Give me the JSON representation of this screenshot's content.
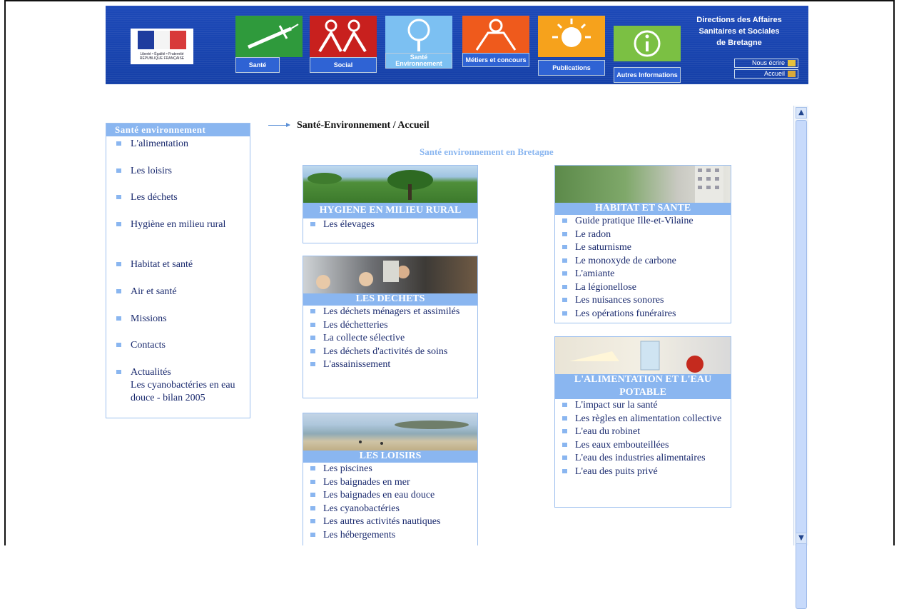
{
  "banner": {
    "logo_caption": "Liberté • Égalité • Fraternité RÉPUBLIQUE FRANÇAISE",
    "tabs": [
      {
        "label": "Santé",
        "color": "#2f9a3c"
      },
      {
        "label": "Social",
        "color": "#c8201e"
      },
      {
        "label": "Santé Environnement",
        "color": "#7cc0f2"
      },
      {
        "label": "Métiers et concours",
        "color": "#ef5a1c"
      },
      {
        "label": "Publications",
        "color": "#f6a21c"
      },
      {
        "label": "Autres Informations",
        "color": "#7bc043"
      }
    ],
    "org_line1": "Directions des Affaires",
    "org_line2": "Sanitaires et Sociales",
    "org_line3": "de Bretagne",
    "write_label": "Nous écrire",
    "home_label": "Accueil"
  },
  "sidebar": {
    "title": "Santé environnement",
    "items": [
      "L'alimentation",
      "Les loisirs",
      "Les déchets",
      "Hygiène en milieu rural",
      "Habitat et santé",
      "Air et santé",
      "Missions",
      "Contacts",
      "Actualités",
      "Les cyanobactéries en eau douce - bilan 2005"
    ]
  },
  "main": {
    "breadcrumb": "Santé-Environnement / Accueil",
    "subtitle": "Santé environnement en Bretagne",
    "sections": {
      "hygiene": {
        "title": "HYGIENE EN MILIEU RURAL",
        "links": [
          "Les élevages"
        ]
      },
      "dechets": {
        "title": "LES DECHETS",
        "links": [
          "Les déchets ménagers et assimilés",
          "Les déchetteries",
          "La collecte sélective",
          "Les déchets d'activités de soins",
          "L'assainissement"
        ]
      },
      "loisirs": {
        "title": "LES LOISIRS",
        "links": [
          "Les piscines",
          "Les baignades en mer",
          "Les baignades en eau douce",
          "Les cyanobactéries",
          "Les autres activités nautiques",
          "Les hébergements"
        ]
      },
      "habitat": {
        "title": "HABITAT ET SANTE",
        "links": [
          "Guide pratique Ille-et-Vilaine",
          "Le radon",
          "Le saturnisme",
          "Le monoxyde de carbone",
          "L'amiante",
          "La légionellose",
          "Les nuisances sonores",
          "Les opérations funéraires"
        ]
      },
      "alimentation": {
        "title": "L'ALIMENTATION ET L'EAU POTABLE",
        "links": [
          "L'impact sur la santé",
          "Les règles en alimentation collective",
          "L'eau du robinet",
          "Les eaux embouteillées",
          "L'eau des industries alimentaires",
          "L'eau des puits privé"
        ]
      }
    }
  },
  "scrollbar": {
    "up": "▲",
    "down": "▼"
  }
}
